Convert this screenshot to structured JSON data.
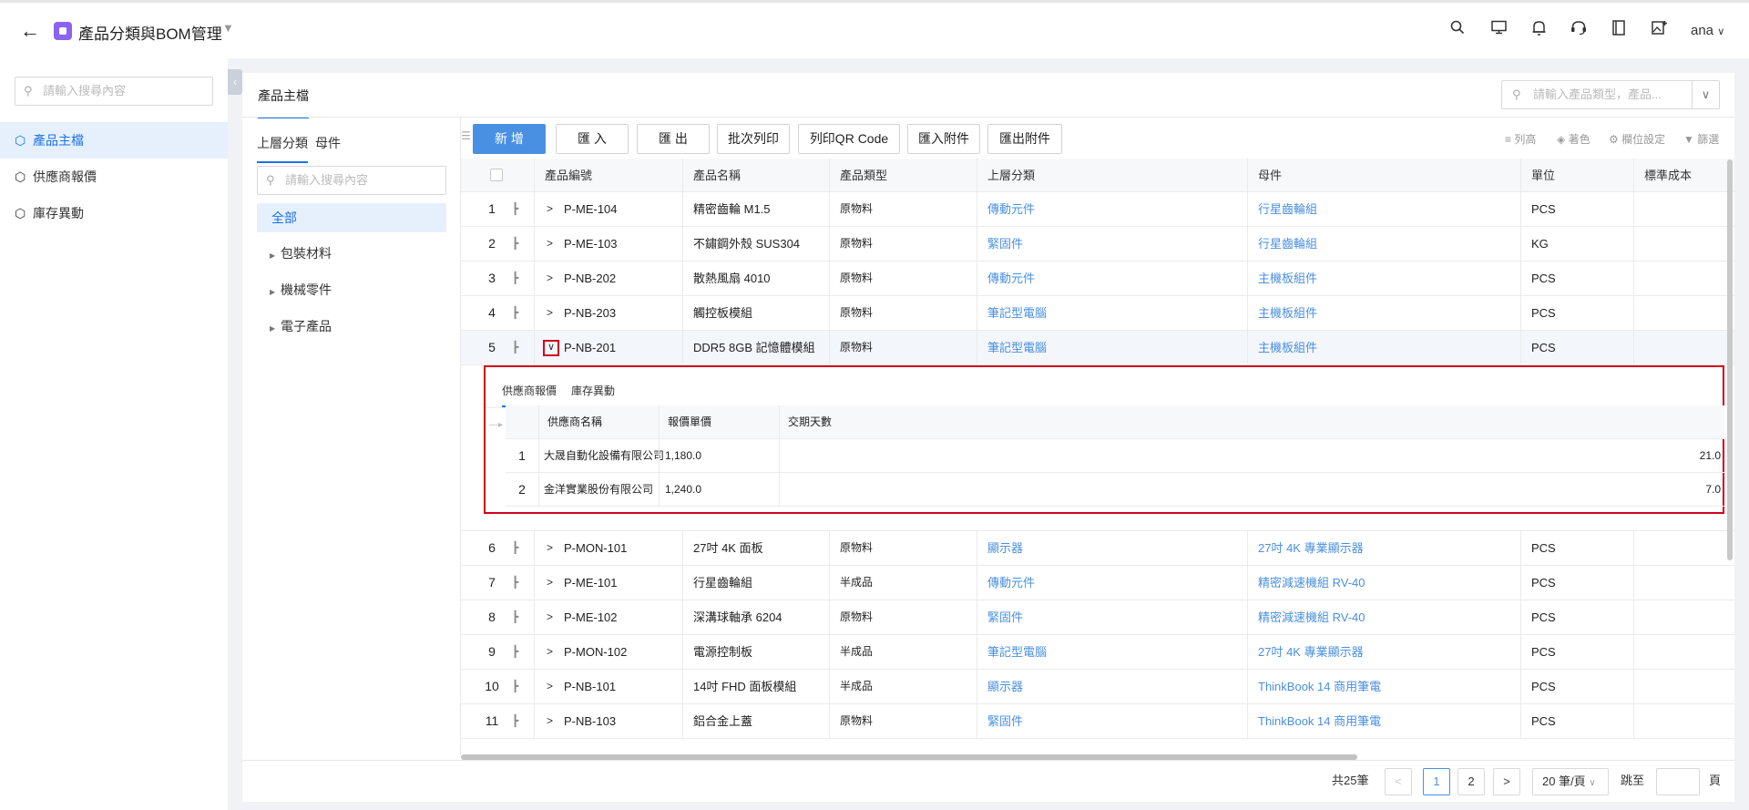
{
  "header": {
    "title": "產品分類與BOM管理",
    "user": "ana"
  },
  "sidebar": {
    "search_placeholder": "請輸入搜尋內容",
    "items": [
      {
        "label": "產品主檔",
        "active": true
      },
      {
        "label": "供應商報價",
        "active": false
      },
      {
        "label": "庫存異動",
        "active": false
      }
    ]
  },
  "main": {
    "tab": "產品主檔",
    "search_placeholder": "請輸入產品類型，產品...",
    "category_panel": {
      "tabs": [
        "上層分類",
        "母件"
      ],
      "search_placeholder": "請輸入搜尋內容",
      "all_label": "全部",
      "items": [
        "包裝材料",
        "機械零件",
        "電子產品"
      ]
    },
    "toolbar": {
      "buttons": [
        "新 增",
        "匯 入",
        "匯 出",
        "批次列印",
        "列印QR Code",
        "匯入附件",
        "匯出附件"
      ],
      "tools": [
        "列高",
        "著色",
        "欄位設定",
        "篩選"
      ]
    },
    "table": {
      "columns": [
        "產品編號",
        "產品名稱",
        "產品類型",
        "上層分類",
        "母件",
        "單位",
        "標準成本"
      ],
      "rows": [
        {
          "no": "1",
          "code": "P-ME-104",
          "name": "精密齒輪 M1.5",
          "type": "原物料",
          "category": "傳動元件",
          "parent": "行星齒輪組",
          "unit": "PCS"
        },
        {
          "no": "2",
          "code": "P-ME-103",
          "name": "不鏽鋼外殼 SUS304",
          "type": "原物料",
          "category": "緊固件",
          "parent": "行星齒輪組",
          "unit": "KG"
        },
        {
          "no": "3",
          "code": "P-NB-202",
          "name": "散熱風扇 4010",
          "type": "原物料",
          "category": "傳動元件",
          "parent": "主機板組件",
          "unit": "PCS"
        },
        {
          "no": "4",
          "code": "P-NB-203",
          "name": "觸控板模組",
          "type": "原物料",
          "category": "筆記型電腦",
          "parent": "主機板組件",
          "unit": "PCS"
        },
        {
          "no": "5",
          "code": "P-NB-201",
          "name": "DDR5 8GB 記憶體模組",
          "type": "原物料",
          "category": "筆記型電腦",
          "parent": "主機板組件",
          "unit": "PCS"
        },
        {
          "no": "6",
          "code": "P-MON-101",
          "name": "27吋 4K 面板",
          "type": "原物料",
          "category": "顯示器",
          "parent": "27吋 4K 專業顯示器",
          "unit": "PCS"
        },
        {
          "no": "7",
          "code": "P-ME-101",
          "name": "行星齒輪組",
          "type": "半成品",
          "category": "傳動元件",
          "parent": "精密減速機組 RV-40",
          "unit": "PCS"
        },
        {
          "no": "8",
          "code": "P-ME-102",
          "name": "深溝球軸承 6204",
          "type": "原物料",
          "category": "緊固件",
          "parent": "精密減速機組 RV-40",
          "unit": "PCS"
        },
        {
          "no": "9",
          "code": "P-MON-102",
          "name": "電源控制板",
          "type": "半成品",
          "category": "筆記型電腦",
          "parent": "27吋 4K 專業顯示器",
          "unit": "PCS"
        },
        {
          "no": "10",
          "code": "P-NB-101",
          "name": "14吋 FHD 面板模組",
          "type": "半成品",
          "category": "顯示器",
          "parent": "ThinkBook 14 商用筆電",
          "unit": "PCS"
        },
        {
          "no": "11",
          "code": "P-NB-103",
          "name": "鋁合金上蓋",
          "type": "原物料",
          "category": "緊固件",
          "parent": "ThinkBook 14 商用筆電",
          "unit": "PCS"
        }
      ]
    },
    "expanded": {
      "tabs": [
        "供應商報價",
        "庫存異動"
      ],
      "columns": [
        "供應商名稱",
        "報價單價",
        "交期天數"
      ],
      "rows": [
        {
          "no": "1",
          "supplier": "大晟自動化設備有限公司",
          "price": "1,180.0",
          "days": "21.0"
        },
        {
          "no": "2",
          "supplier": "金洋實業股份有限公司",
          "price": "1,240.0",
          "days": "7.0"
        }
      ]
    },
    "pagination": {
      "total": "共25筆",
      "pages": [
        "1",
        "2"
      ],
      "page_size": "20 筆/頁",
      "goto": "跳至",
      "page_suffix": "頁"
    }
  }
}
